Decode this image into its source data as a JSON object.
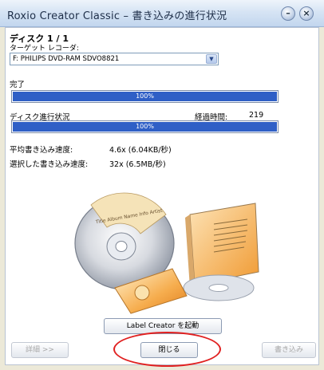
{
  "window": {
    "title": "Roxio Creator Classic – 書き込みの進行状況",
    "minimize_label": "–",
    "close_label": "×"
  },
  "disc": {
    "title": "ディスク 1 / 1",
    "target_label": "ターゲット レコーダ:",
    "target_value": "F:  PHILIPS DVD-RAM SDVO8821"
  },
  "progress": {
    "complete_label": "完了",
    "complete_percent_text": "100%",
    "complete_fraction": 1.0,
    "disc_progress_label": "ディスク進行状況",
    "elapsed_label": "経過時間:",
    "elapsed_value": "219",
    "disc_percent_text": "100%",
    "disc_fraction": 1.0
  },
  "speeds": {
    "avg_label": "平均書き込み速度:",
    "avg_value": "4.6x (6.04KB/秒)",
    "selected_label": "選択した書き込み速度:",
    "selected_value": "32x (6.5MB/秒)"
  },
  "artwork": {
    "disc_label_text": "Title Album Name Info Artist"
  },
  "buttons": {
    "label_creator": "Label Creator を起動",
    "details": "詳細 >>",
    "close": "閉じる",
    "write": "書き込み"
  },
  "colors": {
    "progress_fill": "#2f5fc6",
    "highlight_circle": "#e02020"
  }
}
